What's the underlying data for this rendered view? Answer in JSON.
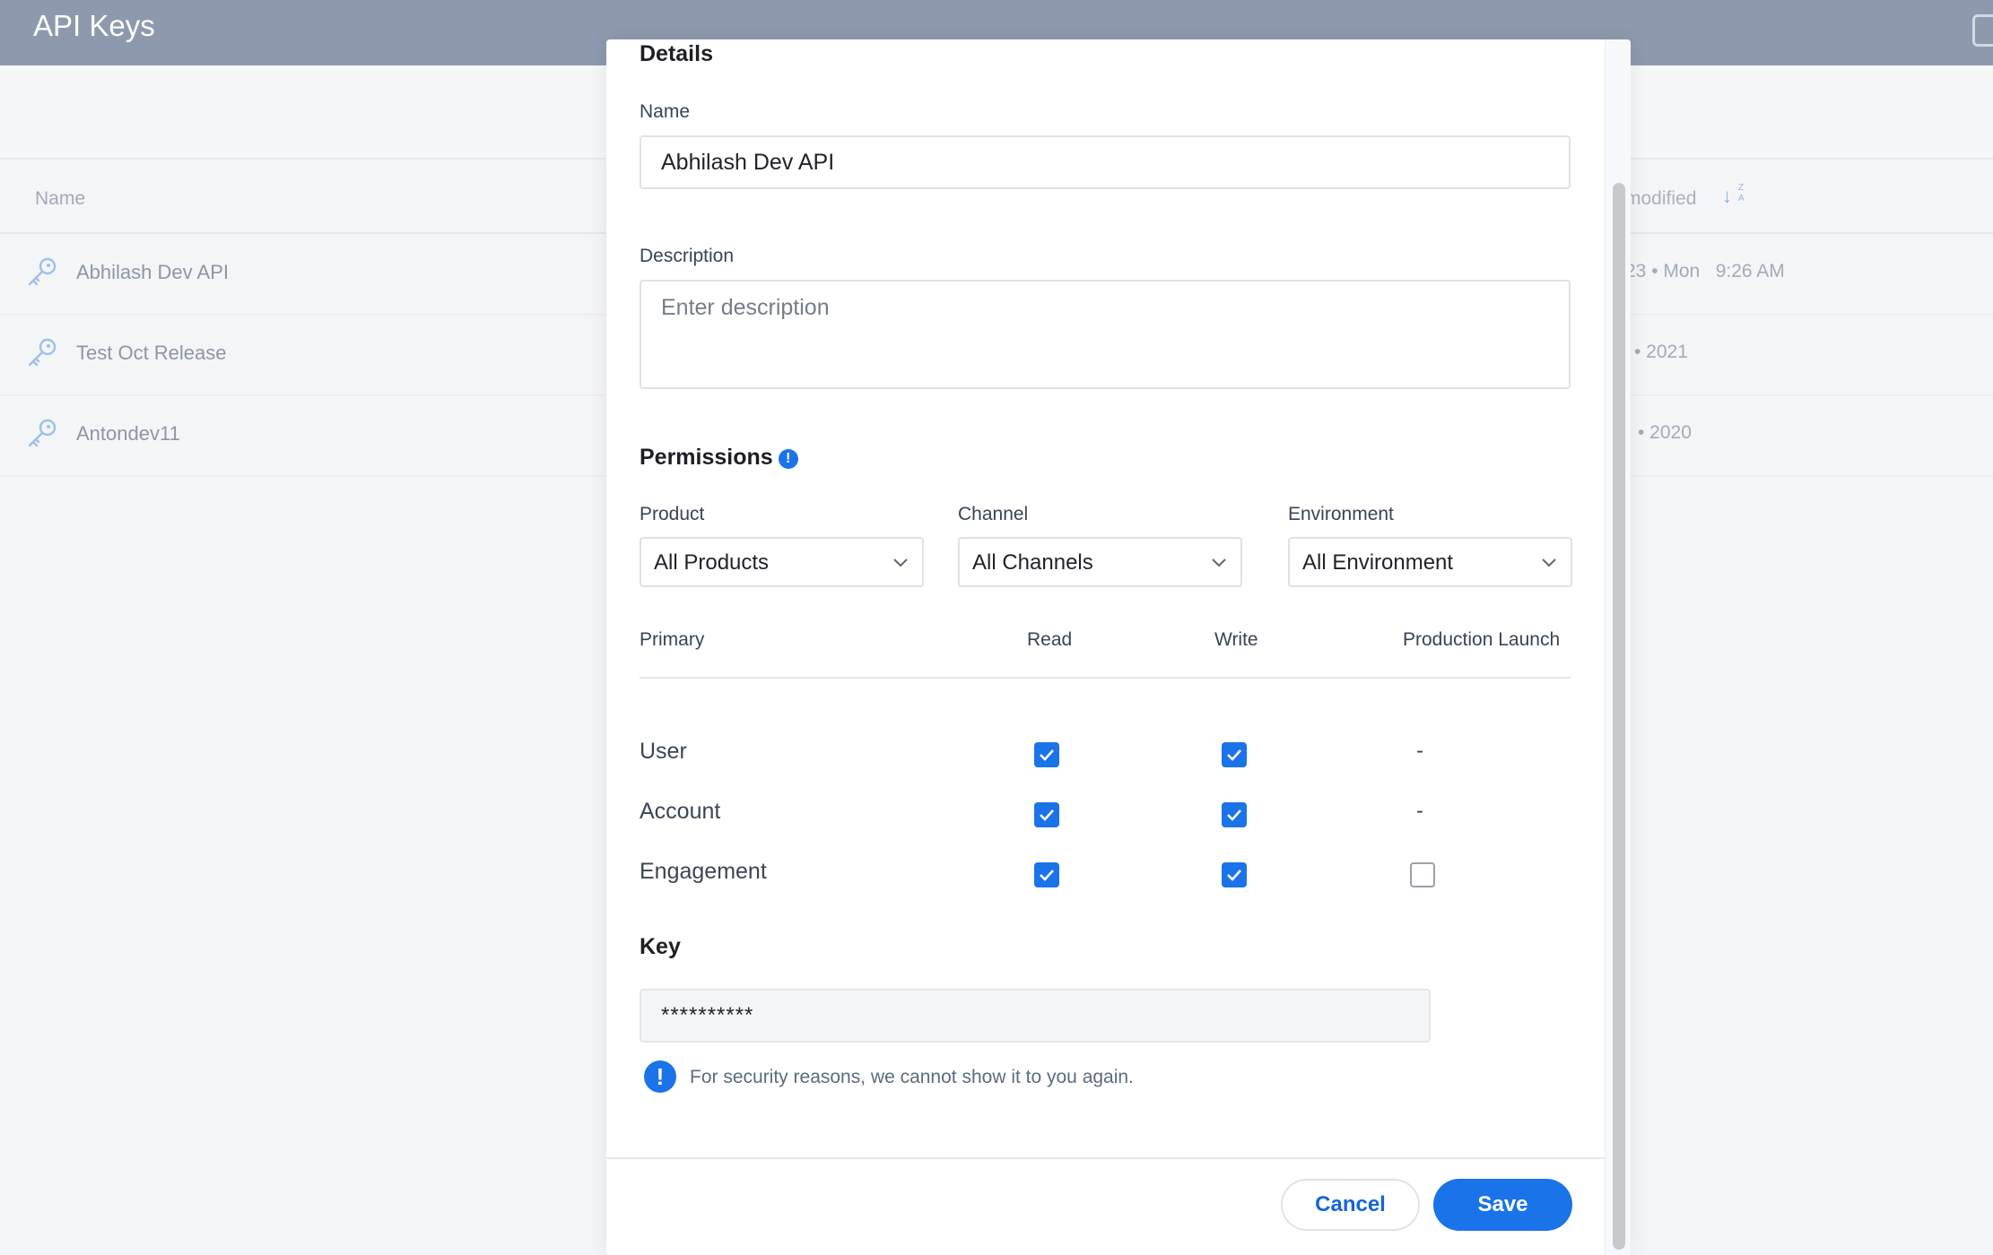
{
  "app": {
    "title": "API Keys"
  },
  "table": {
    "headers": {
      "name": "Name",
      "modified": "modified"
    },
    "sort_glyph": {
      "arrow": "↓",
      "z": "Z",
      "a": "A"
    },
    "rows": [
      {
        "name": "Abhilash Dev API",
        "modified": "23 • Mon   9:26 AM"
      },
      {
        "name": "Test Oct Release",
        "modified": "• 2021"
      },
      {
        "name": "Antondev11",
        "modified": "• 2020"
      }
    ]
  },
  "modal": {
    "title": "Details",
    "name_label": "Name",
    "name_value": "Abhilash Dev API",
    "description_label": "Description",
    "description_placeholder": "Enter description",
    "permissions_title": "Permissions",
    "permissions_info_glyph": "!",
    "product": {
      "label": "Product",
      "value": "All Products"
    },
    "channel": {
      "label": "Channel",
      "value": "All Channels"
    },
    "environment": {
      "label": "Environment",
      "value": "All Environment"
    },
    "columns": {
      "primary": "Primary",
      "read": "Read",
      "write": "Write",
      "production": "Production Launch"
    },
    "permissions": [
      {
        "label": "User",
        "read": true,
        "write": true,
        "production": "-"
      },
      {
        "label": "Account",
        "read": true,
        "write": true,
        "production": "-"
      },
      {
        "label": "Engagement",
        "read": true,
        "write": true,
        "production": false
      }
    ],
    "key_title": "Key",
    "key_value": "**********",
    "note_glyph": "!",
    "security_note": "For security reasons, we cannot show it to you again.",
    "cancel_label": "Cancel",
    "save_label": "Save"
  },
  "colors": {
    "accent": "#1a73e8",
    "topbar": "#8d9aae"
  }
}
